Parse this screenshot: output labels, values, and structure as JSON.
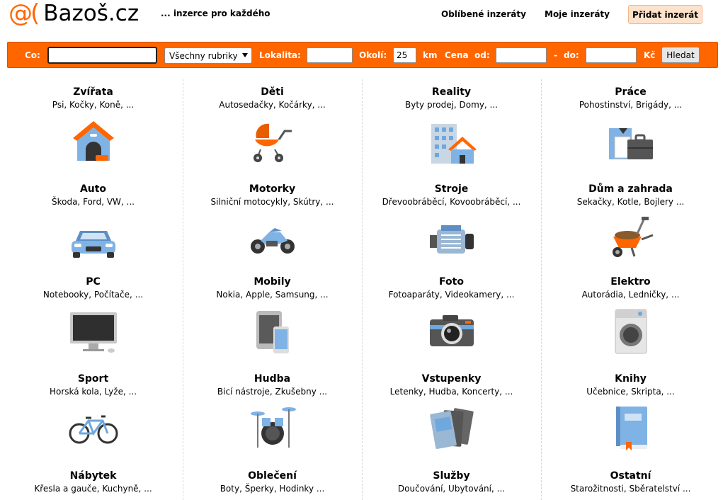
{
  "header": {
    "logo_symbol": "@(",
    "logo_text": "Bazoš.cz",
    "tagline": "... inzerce pro každého",
    "links": {
      "favorites": "Oblíbené inzeráty",
      "my_ads": "Moje inzeráty",
      "add_ad": "Přidat inzerát"
    }
  },
  "search": {
    "what_label": "Co:",
    "what_value": "",
    "category_value": "Všechny rubriky",
    "locality_label": "Lokalita:",
    "locality_value": "",
    "radius_label": "Okolí:",
    "radius_value": "25",
    "radius_unit": "km",
    "price_label": "Cena",
    "price_from_label": "od:",
    "price_from_value": "",
    "price_dash": "-",
    "price_to_label": "do:",
    "price_to_value": "",
    "currency": "Kč",
    "submit_label": "Hledat"
  },
  "categories": [
    {
      "title": "Zvířata",
      "sub": "Psi, Kočky, Koně, ...",
      "icon": "doghouse-icon"
    },
    {
      "title": "Děti",
      "sub": "Autosedačky, Kočárky, ...",
      "icon": "stroller-icon"
    },
    {
      "title": "Reality",
      "sub": "Byty prodej, Domy, ...",
      "icon": "buildings-icon"
    },
    {
      "title": "Práce",
      "sub": "Pohostinství, Brigády, ...",
      "icon": "briefcase-icon"
    },
    {
      "title": "Auto",
      "sub": "Škoda, Ford, VW, ...",
      "icon": "car-icon"
    },
    {
      "title": "Motorky",
      "sub": "Silniční motocykly, Skútry, ...",
      "icon": "motorcycle-icon"
    },
    {
      "title": "Stroje",
      "sub": "Dřevoobráběcí, Kovoobráběcí, ...",
      "icon": "engine-icon"
    },
    {
      "title": "Dům a zahrada",
      "sub": "Sekačky, Kotle, Bojlery ...",
      "icon": "wheelbarrow-icon"
    },
    {
      "title": "PC",
      "sub": "Notebooky, Počítače, ...",
      "icon": "monitor-icon"
    },
    {
      "title": "Mobily",
      "sub": "Nokia, Apple, Samsung, ...",
      "icon": "phones-icon"
    },
    {
      "title": "Foto",
      "sub": "Fotoaparáty, Videokamery, ...",
      "icon": "camera-icon"
    },
    {
      "title": "Elektro",
      "sub": "Autorádia, Ledničky, ...",
      "icon": "washing-machine-icon"
    },
    {
      "title": "Sport",
      "sub": "Horská kola, Lyže, ...",
      "icon": "bicycle-icon"
    },
    {
      "title": "Hudba",
      "sub": "Bicí nástroje, Zkušebny ...",
      "icon": "drums-icon"
    },
    {
      "title": "Vstupenky",
      "sub": "Letenky, Hudba, Koncerty, ...",
      "icon": "tickets-icon"
    },
    {
      "title": "Knihy",
      "sub": "Učebnice, Skripta, ...",
      "icon": "book-icon"
    },
    {
      "title": "Nábytek",
      "sub": "Křesla a gauče, Kuchyně, ...",
      "icon": "sofa-icon"
    },
    {
      "title": "Oblečení",
      "sub": "Boty, Šperky, Hodinky ...",
      "icon": "clothes-icon"
    },
    {
      "title": "Služby",
      "sub": "Doučování, Ubytování, ...",
      "icon": "services-icon"
    },
    {
      "title": "Ostatní",
      "sub": "Starožitnosti, Sběratelství ...",
      "icon": "misc-icon"
    }
  ],
  "colors": {
    "brand": "#ff6600",
    "add_button_bg": "#fde2cc",
    "icon_blue": "#6fa8dc",
    "icon_orange": "#ff6600"
  }
}
